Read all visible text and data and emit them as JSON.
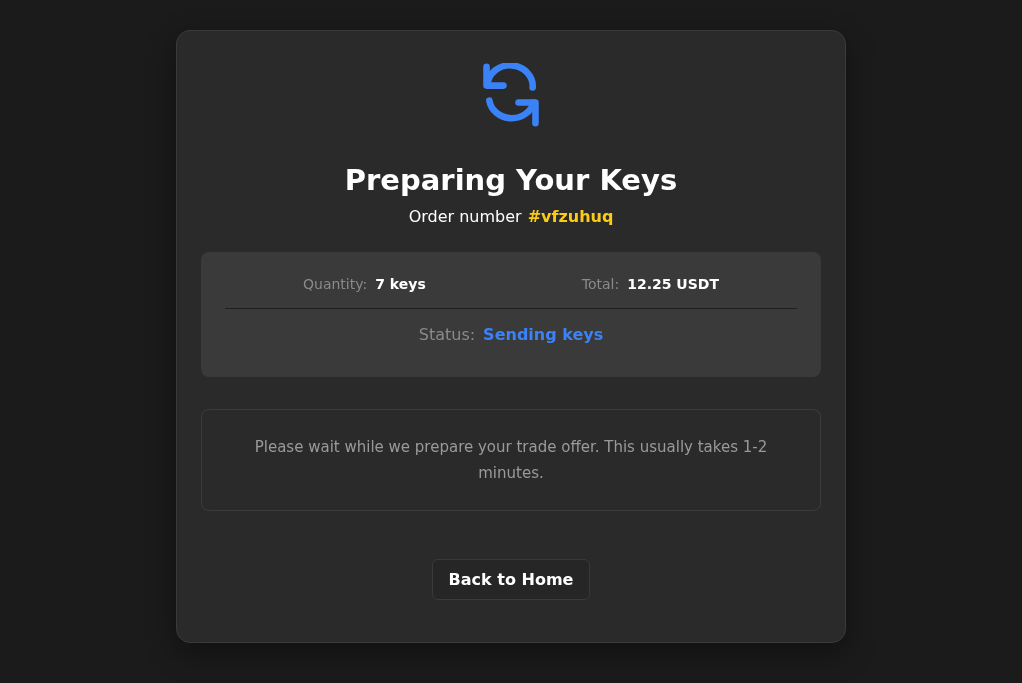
{
  "title": "Preparing Your Keys",
  "order": {
    "label": "Order number",
    "number": "#vfzuhuq"
  },
  "summary": {
    "rows": [
      [
        {
          "label": "Quantity:",
          "value": "7 keys",
          "kind": "plain"
        },
        {
          "label": "Total:",
          "value": "12.25 USDT",
          "kind": "plain"
        }
      ],
      [
        {
          "label": "Status:",
          "value": "Sending keys",
          "kind": "status"
        }
      ]
    ]
  },
  "notice": "Please wait while we prepare your trade offer. This usually takes 1-2 minutes.",
  "button": "Back to Home"
}
